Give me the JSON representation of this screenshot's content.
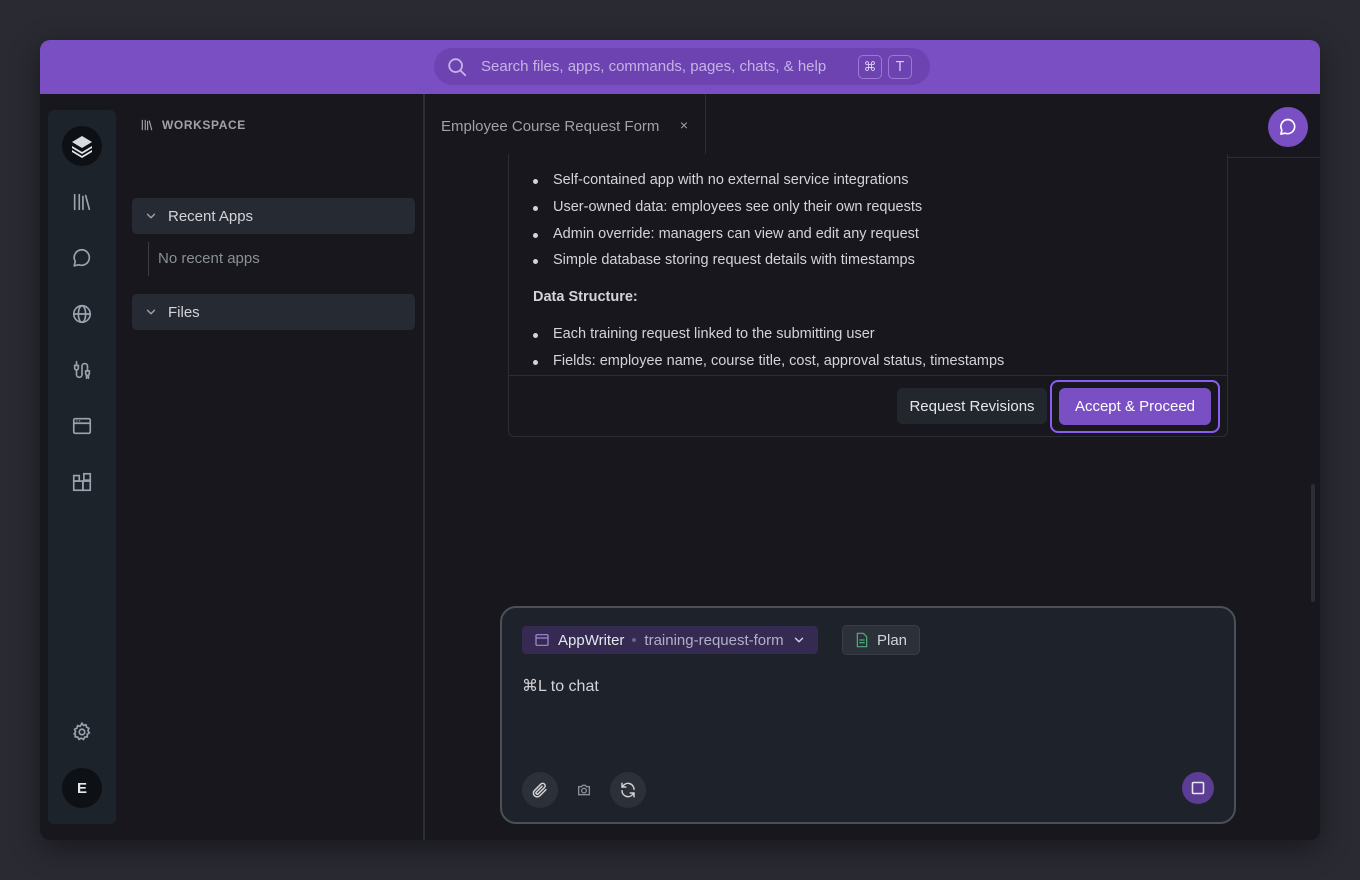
{
  "search": {
    "placeholder": "Search files, apps, commands, pages, chats, & help",
    "shortcut_keys": [
      "⌘",
      "T"
    ]
  },
  "rail": {
    "items": [
      {
        "name": "library-icon"
      },
      {
        "name": "chat-bubble-icon"
      },
      {
        "name": "globe-icon"
      },
      {
        "name": "integrations-icon"
      },
      {
        "name": "browser-window-icon"
      },
      {
        "name": "apps-grid-icon"
      }
    ],
    "settings_icon": "gear-icon",
    "avatar_letter": "E"
  },
  "sidebar": {
    "workspace_label": "WORKSPACE",
    "recent_apps_label": "Recent Apps",
    "no_recent_label": "No recent apps",
    "files_label": "Files"
  },
  "tab": {
    "title": "Employee Course Request Form",
    "close_glyph": "×"
  },
  "plan": {
    "bullets_top": [
      "Self-contained app with no external service integrations",
      "User-owned data: employees see only their own requests",
      "Admin override: managers can view and edit any request",
      "Simple database storing request details with timestamps"
    ],
    "data_structure_heading": "Data Structure:",
    "bullets_data": [
      "Each training request linked to the submitting user",
      "Fields: employee name, course title, cost, approval status, timestamps"
    ],
    "request_revisions_label": "Request Revisions",
    "accept_label": "Accept & Proceed"
  },
  "composer": {
    "app_name": "AppWriter",
    "project_name": "training-request-form",
    "plan_label": "Plan",
    "placeholder": "⌘L to chat"
  },
  "colors": {
    "accent": "#7b4fc4",
    "accent_ring": "#8b5cf6",
    "background": "#17171d"
  }
}
